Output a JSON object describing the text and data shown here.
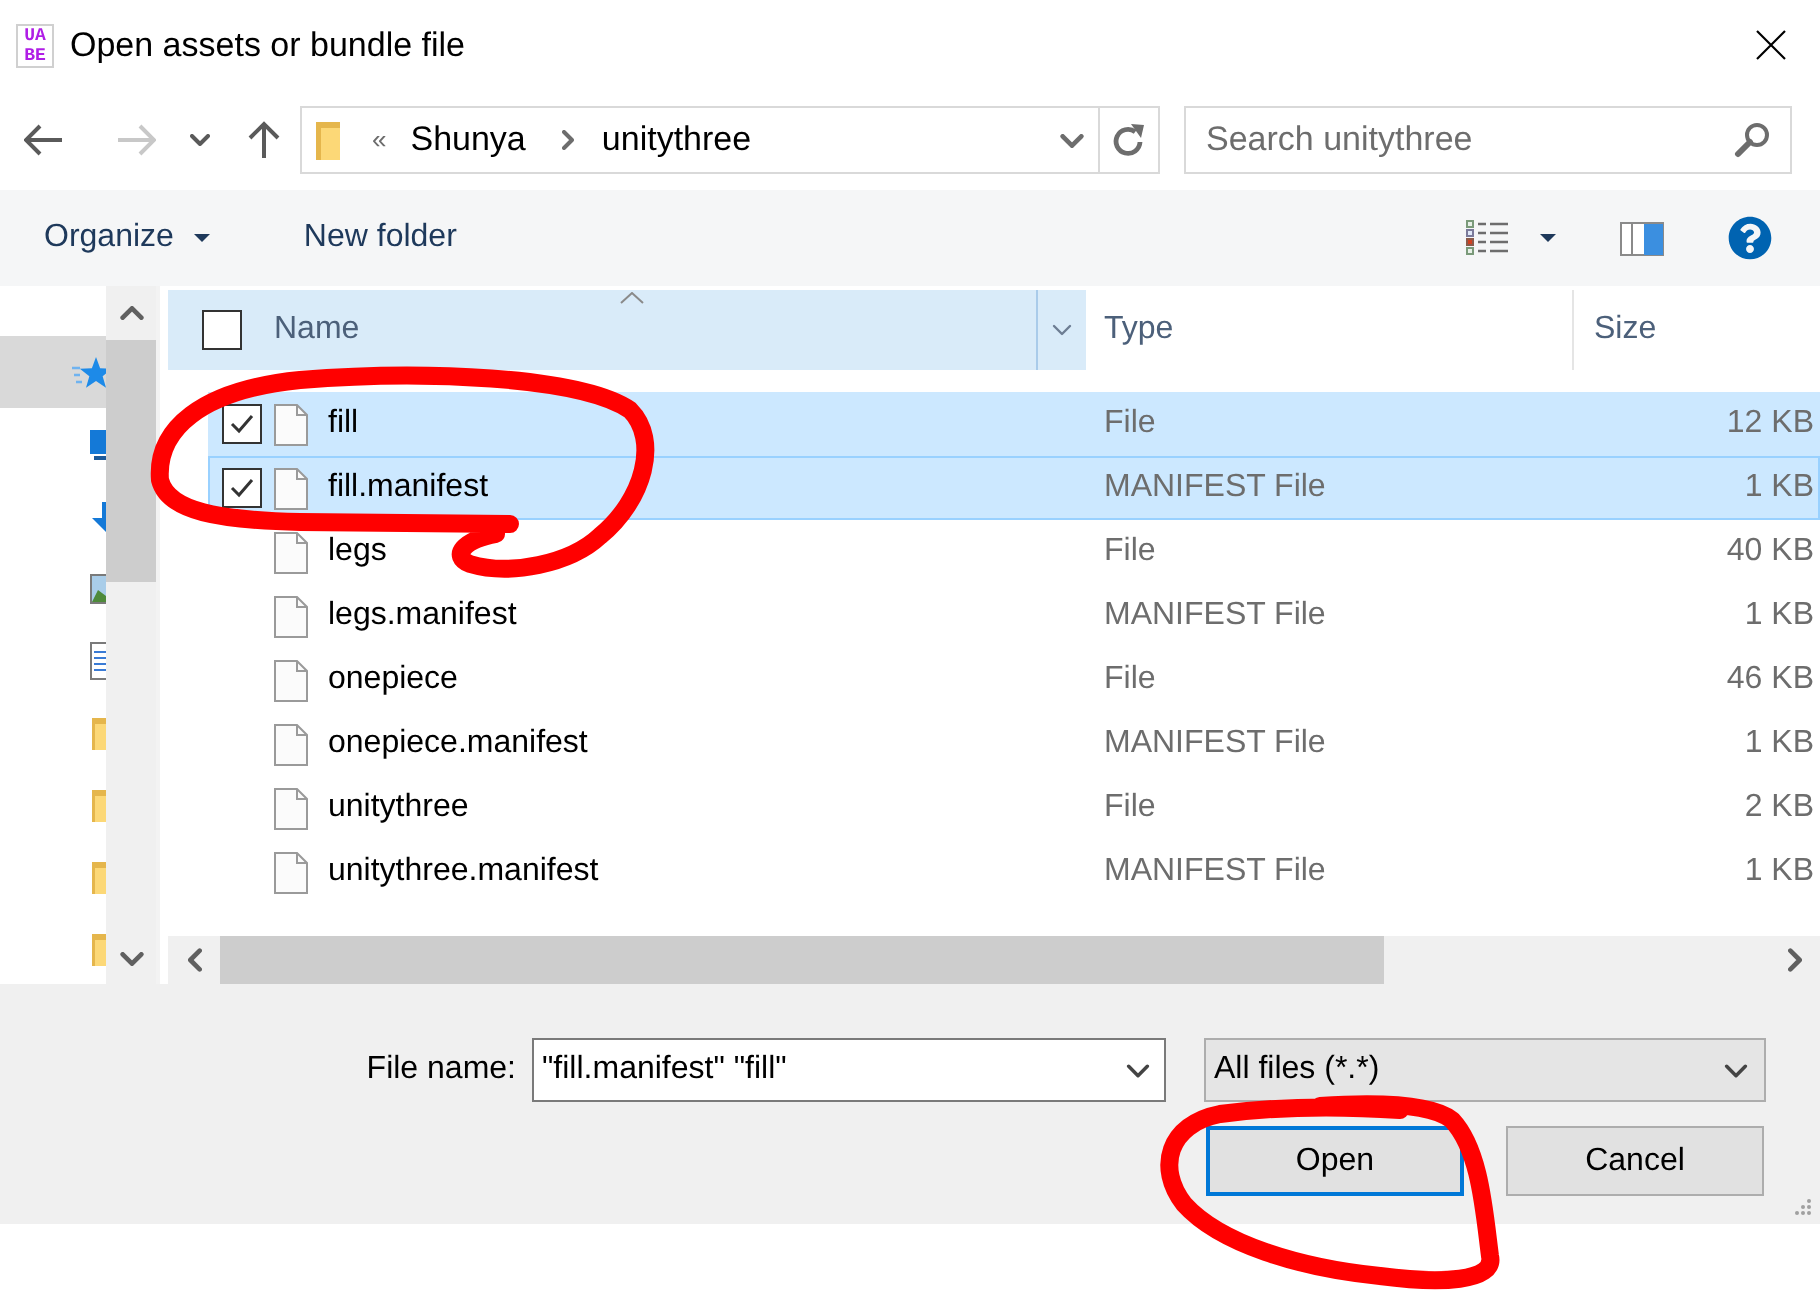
{
  "window": {
    "logo": "UABE",
    "title": "Open assets or bundle file"
  },
  "navigation": {
    "buttons": [
      {
        "kind": "back",
        "disabled": false
      },
      {
        "kind": "forward",
        "disabled": true
      },
      {
        "kind": "recent",
        "disabled": false
      },
      {
        "kind": "up",
        "disabled": false
      }
    ],
    "address": {
      "overflow": "«",
      "path": [
        "Shunya",
        "unitythree"
      ]
    },
    "search": {
      "placeholder": "Search unitythree"
    }
  },
  "toolbar": {
    "organize": "Organize",
    "new_folder": "New folder"
  },
  "nav_pane": {
    "items": [
      {
        "kind": "quick-access",
        "selected": true
      },
      {
        "kind": "desktop",
        "selected": false
      },
      {
        "kind": "downloads",
        "selected": false
      },
      {
        "kind": "pictures",
        "selected": false
      },
      {
        "kind": "documents",
        "selected": false
      },
      {
        "kind": "folder",
        "selected": false
      },
      {
        "kind": "folder",
        "selected": false
      },
      {
        "kind": "folder",
        "selected": false
      },
      {
        "kind": "folder",
        "selected": false
      }
    ]
  },
  "file_list": {
    "select_all": false,
    "columns": [
      {
        "label": "Name",
        "sorted": true,
        "hovered": true
      },
      {
        "label": "Type",
        "sorted": false,
        "hovered": false
      },
      {
        "label": "Size",
        "sorted": false,
        "hovered": false
      }
    ],
    "rows": [
      {
        "name": "fill",
        "type": "File",
        "size": "12 KB",
        "selected": true,
        "focused": false
      },
      {
        "name": "fill.manifest",
        "type": "MANIFEST File",
        "size": "1 KB",
        "selected": true,
        "focused": true
      },
      {
        "name": "legs",
        "type": "File",
        "size": "40 KB",
        "selected": false,
        "focused": false
      },
      {
        "name": "legs.manifest",
        "type": "MANIFEST File",
        "size": "1 KB",
        "selected": false,
        "focused": false
      },
      {
        "name": "onepiece",
        "type": "File",
        "size": "46 KB",
        "selected": false,
        "focused": false
      },
      {
        "name": "onepiece.manifest",
        "type": "MANIFEST File",
        "size": "1 KB",
        "selected": false,
        "focused": false
      },
      {
        "name": "unitythree",
        "type": "File",
        "size": "2 KB",
        "selected": false,
        "focused": false
      },
      {
        "name": "unitythree.manifest",
        "type": "MANIFEST File",
        "size": "1 KB",
        "selected": false,
        "focused": false
      }
    ]
  },
  "footer": {
    "file_name": {
      "label": "File name:",
      "value": "\"fill.manifest\" \"fill\""
    },
    "filter": "All files (*.*)",
    "buttons": [
      {
        "label": "Open",
        "default": true
      },
      {
        "label": "Cancel",
        "default": false
      }
    ]
  }
}
